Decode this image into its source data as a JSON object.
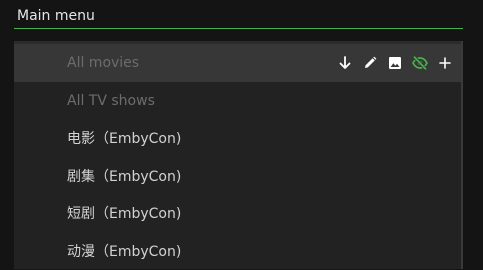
{
  "header": {
    "title": "Main menu"
  },
  "menu": {
    "items": [
      {
        "label": "All movies",
        "disabled": true,
        "selected": true
      },
      {
        "label": "All TV shows",
        "disabled": true,
        "selected": false
      },
      {
        "label": "电影（EmbyCon)",
        "disabled": false,
        "selected": false
      },
      {
        "label": "剧集（EmbyCon)",
        "disabled": false,
        "selected": false
      },
      {
        "label": "短剧（EmbyCon)",
        "disabled": false,
        "selected": false
      },
      {
        "label": "动漫（EmbyCon)",
        "disabled": false,
        "selected": false
      }
    ]
  },
  "actions": [
    {
      "icon": "arrow-down-icon",
      "color": "#ffffff"
    },
    {
      "icon": "pencil-icon",
      "color": "#ffffff"
    },
    {
      "icon": "image-icon",
      "color": "#ffffff"
    },
    {
      "icon": "eye-off-icon",
      "color": "#4caf50"
    },
    {
      "icon": "plus-icon",
      "color": "#ffffff"
    }
  ],
  "colors": {
    "accent": "#4caf50",
    "background": "#141414",
    "panel": "#222222",
    "selected_row": "#373737",
    "text": "#d2d2d2",
    "text_disabled": "#6c6c6c"
  }
}
